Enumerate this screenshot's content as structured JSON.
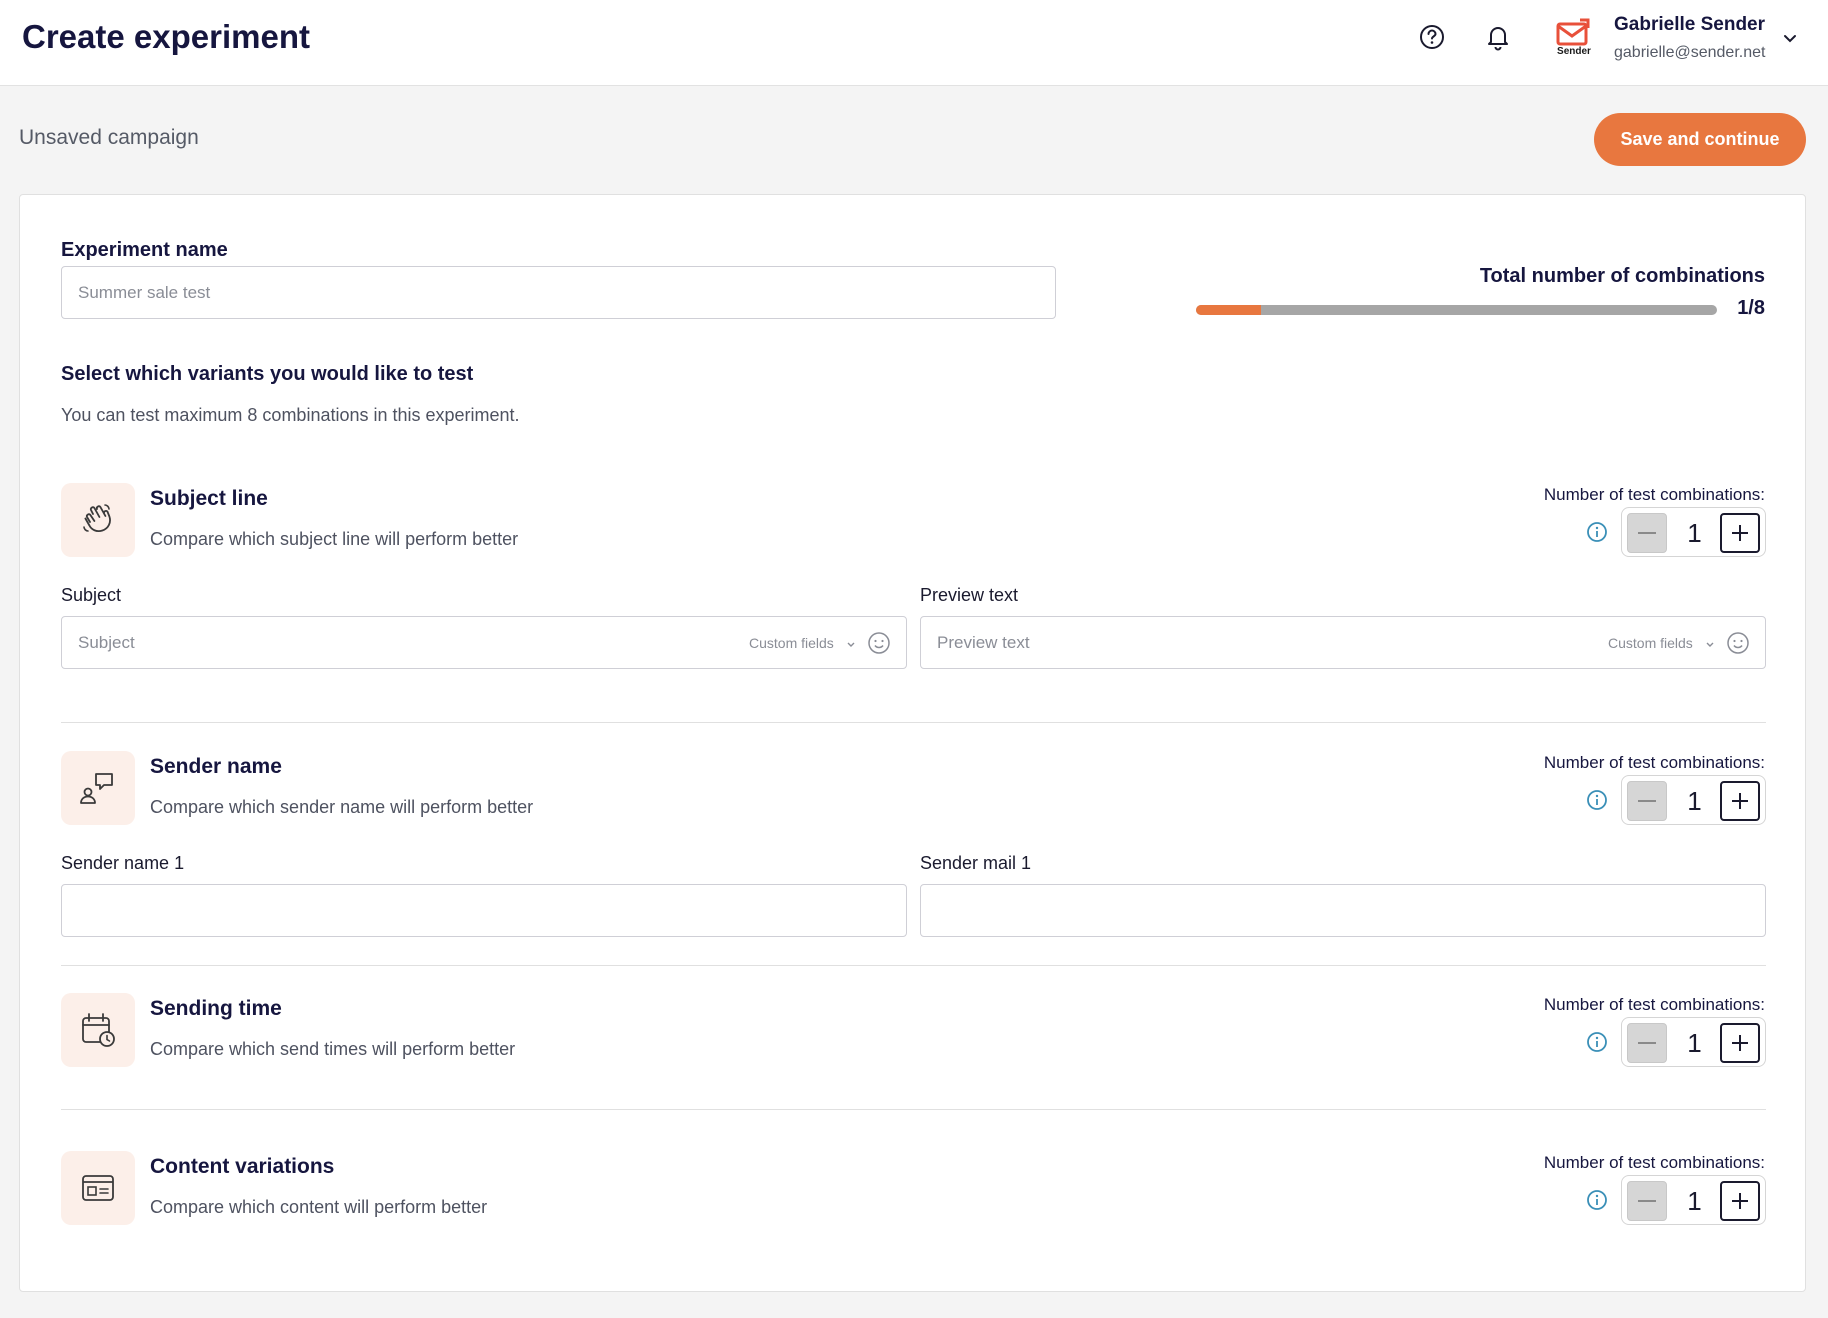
{
  "header": {
    "title": "Create experiment",
    "help_icon": "help-circle-icon",
    "notifications_icon": "bell-icon",
    "logo_text": "Sender",
    "user_name": "Gabrielle Sender",
    "user_email": "gabrielle@sender.net"
  },
  "subheader": {
    "campaign_state": "Unsaved campaign",
    "save_label": "Save and continue"
  },
  "experiment": {
    "name_label": "Experiment name",
    "name_placeholder": "Summer sale test",
    "variants_title": "Select which variants you would like to test",
    "variants_hint": "You can test maximum 8 combinations in this experiment."
  },
  "combinations": {
    "title": "Total number of combinations",
    "count": "1/8",
    "progress_fraction": 0.125
  },
  "combo_label": "Number of test combinations:",
  "sections": {
    "subject": {
      "title": "Subject line",
      "description": "Compare which subject line will perform better",
      "icon": "hand-wave-icon",
      "value": "1",
      "subject_label": "Subject",
      "subject_placeholder": "Subject",
      "preview_label": "Preview text",
      "preview_placeholder": "Preview text",
      "custom_fields": "Custom fields"
    },
    "sender": {
      "title": "Sender name",
      "description": "Compare which sender name will perform better",
      "icon": "person-chat-icon",
      "value": "1",
      "name_label": "Sender name 1",
      "mail_label": "Sender mail 1"
    },
    "time": {
      "title": "Sending time",
      "description": "Compare which send times will perform better",
      "icon": "calendar-clock-icon",
      "value": "1"
    },
    "content": {
      "title": "Content variations",
      "description": "Compare which content will perform better",
      "icon": "layout-card-icon",
      "value": "1"
    }
  },
  "colors": {
    "accent": "#e8773f",
    "title": "#16163f",
    "info": "#3a8fb7"
  }
}
